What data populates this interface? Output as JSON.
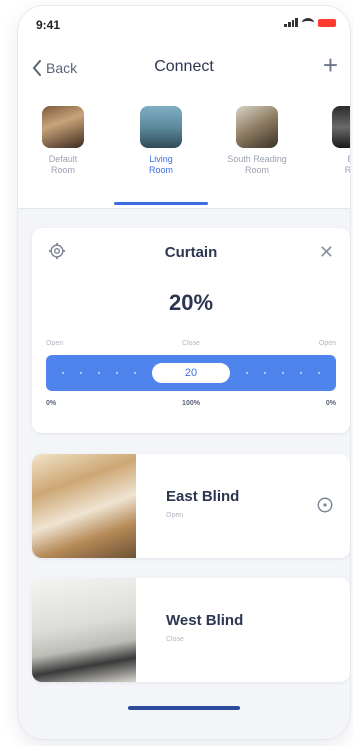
{
  "status": {
    "time": "9:41"
  },
  "nav": {
    "back_label": "Back",
    "title": "Connect",
    "add_label": "+"
  },
  "rooms": [
    {
      "label_line1": "Default",
      "label_line2": "Room",
      "active": false
    },
    {
      "label_line1": "Living",
      "label_line2": "Room",
      "active": true
    },
    {
      "label_line1": "South Reading",
      "label_line2": "Room",
      "active": false
    },
    {
      "label_line1": "Be",
      "label_line2": "Roo",
      "active": false
    }
  ],
  "curtain": {
    "title": "Curtain",
    "percent_text": "20%",
    "slider_value": "20",
    "left_label": "Open",
    "center_label": "Close",
    "right_label": "Open",
    "left_pct": "0%",
    "center_pct": "100%",
    "right_pct": "0%"
  },
  "blinds": [
    {
      "name": "East Blind",
      "status": "Open"
    },
    {
      "name": "West Blind",
      "status": "Close"
    }
  ],
  "colors": {
    "accent": "#4f84ec",
    "accent_dark": "#3b6fe0",
    "card": "#ffffff",
    "bg": "#f3f5f9"
  },
  "icons": {
    "back": "chevron-left-icon",
    "add": "plus-icon",
    "settings": "gear-icon",
    "close": "close-icon",
    "timer": "timer-icon"
  }
}
